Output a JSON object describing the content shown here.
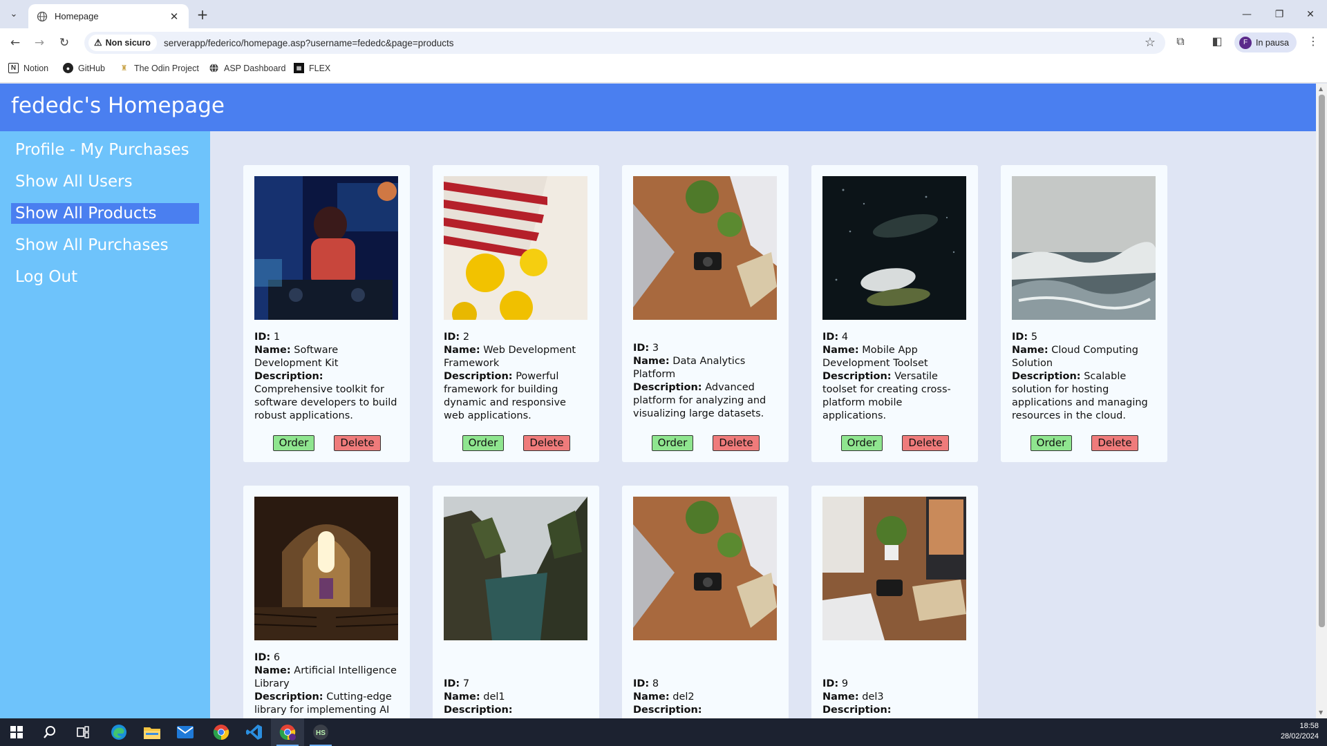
{
  "browser": {
    "tab_title": "Homepage",
    "security_label": "Non sicuro",
    "url": "serverapp/federico/homepage.asp?username=fededc&page=products",
    "profile_initial": "F",
    "profile_status": "In pausa",
    "bookmarks": [
      {
        "label": "Notion",
        "icon": "notion-icon"
      },
      {
        "label": "GitHub",
        "icon": "github-icon"
      },
      {
        "label": "The Odin Project",
        "icon": "odin-icon"
      },
      {
        "label": "ASP Dashboard",
        "icon": "globe-icon"
      },
      {
        "label": "FLEX",
        "icon": "flex-icon"
      }
    ]
  },
  "site": {
    "title": "fededc's Homepage",
    "nav": [
      {
        "label": "Profile - My Purchases",
        "active": false
      },
      {
        "label": "Show All Users",
        "active": false
      },
      {
        "label": "Show All Products",
        "active": true
      },
      {
        "label": "Show All Purchases",
        "active": false
      },
      {
        "label": "Log Out",
        "active": false
      }
    ]
  },
  "labels": {
    "id": "ID:",
    "name": "Name:",
    "description": "Description:",
    "order": "Order",
    "delete": "Delete"
  },
  "products": [
    {
      "id": "1",
      "name": "Software Development Kit",
      "description": "Comprehensive toolkit for software developers to build robust applications.",
      "image": "dj-at-turntables"
    },
    {
      "id": "2",
      "name": "Web Development Framework",
      "description": "Powerful framework for building dynamic and responsive web applications.",
      "image": "lemons-in-striped-bag"
    },
    {
      "id": "3",
      "name": "Data Analytics Platform",
      "description": "Advanced platform for analyzing and visualizing large datasets.",
      "image": "desk-with-plant-and-camera"
    },
    {
      "id": "4",
      "name": "Mobile App Development Toolset",
      "description": "Versatile toolset for creating cross-platform mobile applications.",
      "image": "fish-underwater"
    },
    {
      "id": "5",
      "name": "Cloud Computing Solution",
      "description": "Scalable solution for hosting applications and managing resources in the cloud.",
      "image": "ocean-waves"
    },
    {
      "id": "6",
      "name": "Artificial Intelligence Library",
      "description": "Cutting-edge library for implementing AI",
      "image": "cathedral-interior"
    },
    {
      "id": "7",
      "name": "del1",
      "description": "",
      "image": "coastal-cliffs"
    },
    {
      "id": "8",
      "name": "del2",
      "description": "",
      "image": "desk-with-plant-and-camera"
    },
    {
      "id": "9",
      "name": "del3",
      "description": "",
      "image": "desk-with-monitor-and-plant"
    }
  ],
  "taskbar": {
    "time": "18:58",
    "date": "28/02/2024",
    "apps": [
      "windows-start-icon",
      "search-icon",
      "task-view-icon",
      "edge-icon",
      "file-explorer-icon",
      "mail-icon",
      "chrome-icon",
      "vscode-icon",
      "chrome-profile-icon",
      "hs-app-icon"
    ]
  }
}
